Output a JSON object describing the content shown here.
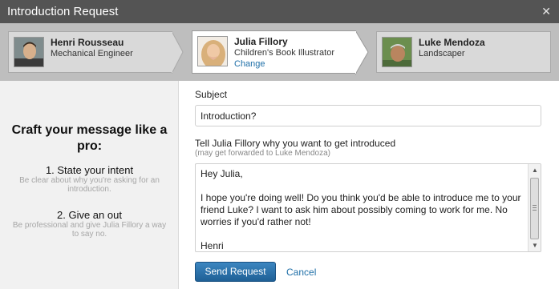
{
  "dialog": {
    "title": "Introduction Request",
    "close_icon": "✕"
  },
  "people": {
    "sender": {
      "name": "Henri Rousseau",
      "role": "Mechanical Engineer"
    },
    "introducer": {
      "name": "Julia Fillory",
      "role": "Children's Book Illustrator",
      "change_label": "Change"
    },
    "recipient": {
      "name": "Luke Mendoza",
      "role": "Landscaper"
    }
  },
  "tips": {
    "heading": "Craft your message like a pro:",
    "items": [
      {
        "title": "1. State your intent",
        "body": "Be clear about why you're asking for an introduction."
      },
      {
        "title": "2. Give an out",
        "body": "Be professional and give Julia Fillory a way to say no."
      }
    ]
  },
  "form": {
    "subject_label": "Subject",
    "subject_value": "Introduction?",
    "message_label": "Tell Julia Fillory why you want to get introduced",
    "message_sublabel": "(may get forwarded to Luke Mendoza)",
    "message_paragraphs": [
      "Hey Julia,",
      "I hope you're doing well! Do you think you'd be able to introduce me to your friend Luke? I want to ask him about possibly coming to work for me. No worries if you'd rather not!",
      "Henri"
    ],
    "send_label": "Send Request",
    "cancel_label": "Cancel"
  },
  "colors": {
    "titlebar": "#545454",
    "strip": "#bebebe",
    "accent": "#1e6fa8",
    "button": "#2a6fa8"
  }
}
